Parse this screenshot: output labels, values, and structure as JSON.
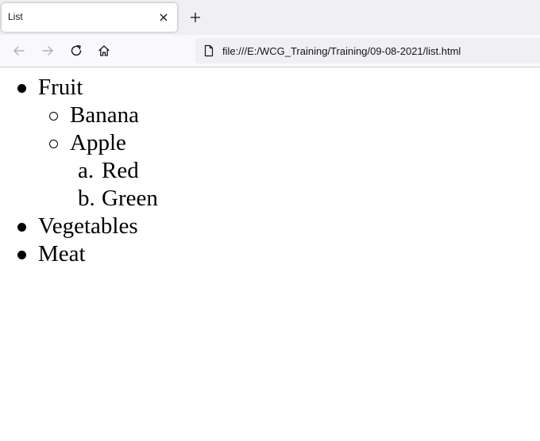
{
  "browser": {
    "tab": {
      "title": "List"
    },
    "address_bar": {
      "url": "file:///E:/WCG_Training/Training/09-08-2021/list.html"
    }
  },
  "page": {
    "list": [
      {
        "label": "Fruit",
        "children": [
          {
            "label": "Banana"
          },
          {
            "label": "Apple",
            "children": [
              {
                "marker": "a.",
                "label": "Red"
              },
              {
                "marker": "b.",
                "label": "Green"
              }
            ]
          }
        ]
      },
      {
        "label": "Vegetables"
      },
      {
        "label": "Meat"
      }
    ]
  },
  "icons": {
    "tab_close": "close-icon",
    "new_tab": "plus-icon",
    "back": "arrow-left-icon",
    "forward": "arrow-right-icon",
    "reload": "reload-icon",
    "home": "home-icon",
    "page": "page-icon"
  },
  "colors": {
    "tabstrip": "#f0f0f4",
    "navbar": "#f9f9fb",
    "urlbar": "#f0f0f4",
    "text": "#15141a"
  }
}
